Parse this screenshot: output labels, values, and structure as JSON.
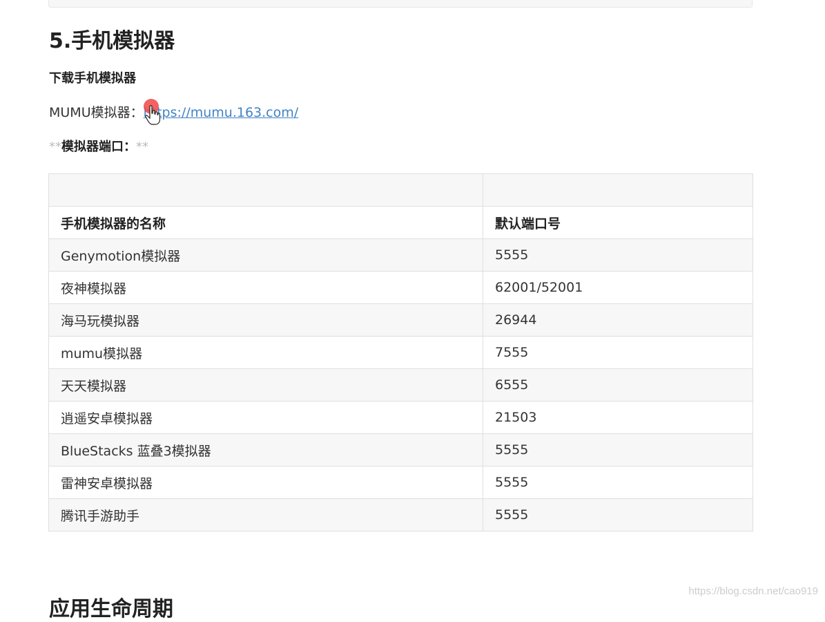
{
  "section": {
    "title": "5.手机模拟器",
    "subtitle": "下载手机模拟器",
    "mumu_label": "MUMU模拟器：",
    "mumu_link": "https://mumu.163.com/",
    "port_stars_open": "**",
    "port_label": "模拟器端口：",
    "port_stars_close": "**"
  },
  "table": {
    "headers": [
      "手机模拟器的名称",
      "默认端口号"
    ],
    "rows": [
      [
        "Genymotion模拟器",
        "5555"
      ],
      [
        "夜神模拟器",
        "62001/52001"
      ],
      [
        "海马玩模拟器",
        "26944"
      ],
      [
        "mumu模拟器",
        "7555"
      ],
      [
        "天天模拟器",
        "6555"
      ],
      [
        "逍遥安卓模拟器",
        "21503"
      ],
      [
        "BlueStacks 蓝叠3模拟器",
        "5555"
      ],
      [
        "雷神安卓模拟器",
        "5555"
      ],
      [
        "腾讯手游助手",
        "5555"
      ]
    ]
  },
  "next_section_title": "应用生命周期",
  "watermark": "https://blog.csdn.net/cao919",
  "colors": {
    "link": "#4183c4",
    "cursor": "#f04646",
    "row_alt": "#f7f7f7"
  },
  "icons": {
    "cursor": "hand-pointer-icon"
  }
}
